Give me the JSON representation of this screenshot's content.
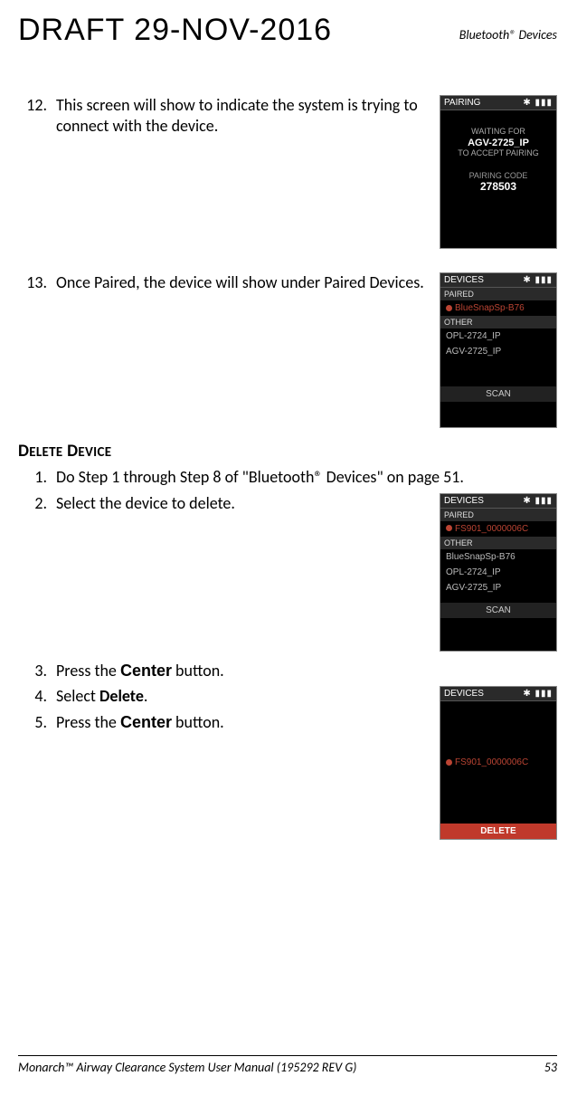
{
  "header": {
    "draft": "DRAFT 29-NOV-2016",
    "right": "Bluetooth® Devices"
  },
  "step12": {
    "num": "12.",
    "text": "This screen will show to indicate the system is trying to connect with the device."
  },
  "step13": {
    "num": "13.",
    "text": "Once Paired, the device will show under Paired Devices."
  },
  "heading": "DELETE DEVICE",
  "d1": {
    "num": "1.",
    "text_a": "Do Step 1 through Step 8 of \"Bluetooth® Devices\" on page 51."
  },
  "d2": {
    "num": "2.",
    "text": "Select the device to delete."
  },
  "d3": {
    "num": "3.",
    "pre": "Press the ",
    "btn": "Center",
    "post": " button."
  },
  "d4": {
    "num": "4.",
    "pre": "Select ",
    "bold": "Delete",
    "post": "."
  },
  "d5": {
    "num": "5.",
    "pre": "Press the ",
    "btn": "Center",
    "post": " button."
  },
  "shot12": {
    "title": "PAIRING",
    "icons": "✱ ▮▮▮",
    "wait1": "WAITING FOR",
    "dev": "AGV-2725_IP",
    "wait2": "TO ACCEPT PAIRING",
    "pclabel": "PAIRING CODE",
    "pcode": "278503"
  },
  "shot13": {
    "title": "DEVICES",
    "icons": "✱ ▮▮▮",
    "paired_h": "PAIRED",
    "paired1": "BlueSnapSp-B76",
    "other_h": "OTHER",
    "other1": "OPL-2724_IP",
    "other2": "AGV-2725_IP",
    "scan": "SCAN"
  },
  "shotD2": {
    "title": "DEVICES",
    "icons": "✱ ▮▮▮",
    "paired_h": "PAIRED",
    "paired1": "FS901_0000006C",
    "other_h": "OTHER",
    "other1": "BlueSnapSp-B76",
    "other2": "OPL-2724_IP",
    "other3": "AGV-2725_IP",
    "scan": "SCAN"
  },
  "shotD5": {
    "title": "DEVICES",
    "icons": "✱ ▮▮▮",
    "dev": "FS901_0000006C",
    "delete": "DELETE"
  },
  "footer": {
    "left": "Monarch™ Airway Clearance System User Manual (195292 REV G)",
    "right": "53"
  }
}
